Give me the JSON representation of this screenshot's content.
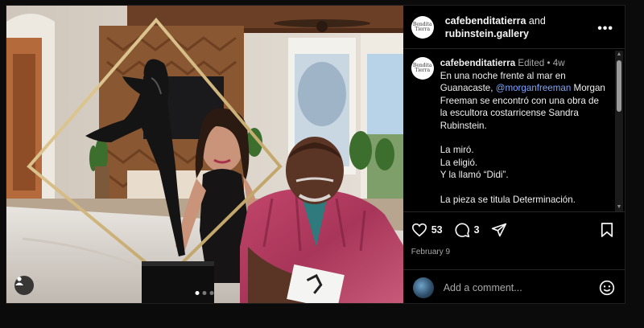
{
  "post": {
    "header": {
      "avatar_text": "Bendita Tierra",
      "account_1": "cafebenditatierra",
      "joiner": " and",
      "account_2": "rubinstein.gallery",
      "more_label": "•••"
    },
    "caption": {
      "avatar_text": "Bendita Tierra",
      "username": "cafebenditatierra",
      "edited": " Edited",
      "separator": " • ",
      "age": "4w",
      "line1_pre": "En una noche frente al mar en Guanacaste, ",
      "mention": "@morganfreeman",
      "line1_post": " Morgan Freeman se encontró con una obra de la escultora costarricense Sandra Rubinstein.",
      "line2": "La miró.",
      "line3": "La eligió.",
      "line4": "Y la llamó “Didi”.",
      "line5": "La pieza se titula Determinación."
    },
    "actions": {
      "like_count": "53",
      "comment_count": "3",
      "date": "February 9"
    },
    "comment_box": {
      "placeholder": "Add a comment..."
    },
    "carousel": {
      "current": 1,
      "total": 3
    },
    "colors": {
      "background": "#000000",
      "mention": "#7ea7ff",
      "muted": "#a8a8a8"
    },
    "icons": [
      "heart-icon",
      "comment-icon",
      "share-icon",
      "bookmark-icon",
      "emoji-icon",
      "user-tag-icon",
      "more-icon"
    ]
  }
}
